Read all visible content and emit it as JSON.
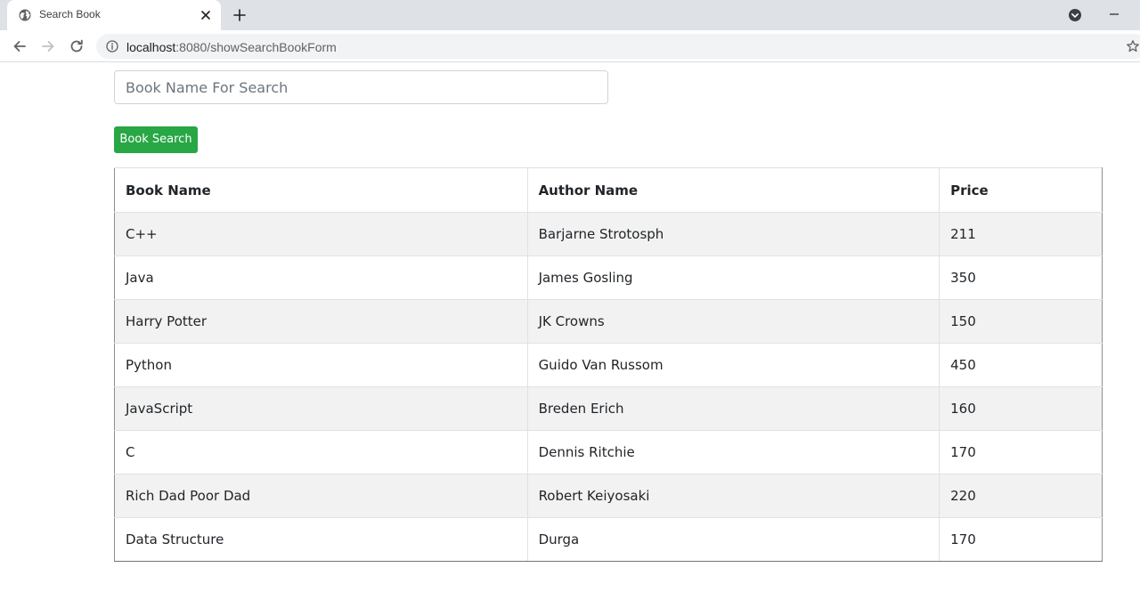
{
  "browser": {
    "tab_title": "Search Book",
    "url_host": "localhost",
    "url_path": ":8080/showSearchBookForm"
  },
  "search": {
    "placeholder": "Book Name For Search",
    "button_label": "Book Search",
    "button_color": "#28a745"
  },
  "table": {
    "headers": [
      "Book Name",
      "Author Name",
      "Price"
    ],
    "rows": [
      [
        "C++",
        "Barjarne Strotosph",
        "211"
      ],
      [
        "Java",
        "James Gosling",
        "350"
      ],
      [
        "Harry Potter",
        "JK Crowns",
        "150"
      ],
      [
        "Python",
        "Guido Van Russom",
        "450"
      ],
      [
        "JavaScript",
        "Breden Erich",
        "160"
      ],
      [
        "C",
        "Dennis Ritchie",
        "170"
      ],
      [
        "Rich Dad Poor Dad",
        "Robert Keiyosaki",
        "220"
      ],
      [
        "Data Structure",
        "Durga",
        "170"
      ]
    ]
  },
  "icons": {
    "favicon": "globe-icon",
    "tab_close": "close-icon",
    "new_tab": "plus-icon",
    "back": "back-arrow-icon",
    "forward": "forward-arrow-icon",
    "reload": "reload-icon",
    "site_info": "info-icon",
    "bookmark": "star-icon",
    "tab_search": "tab-search-icon",
    "minimize": "minimize-icon"
  }
}
